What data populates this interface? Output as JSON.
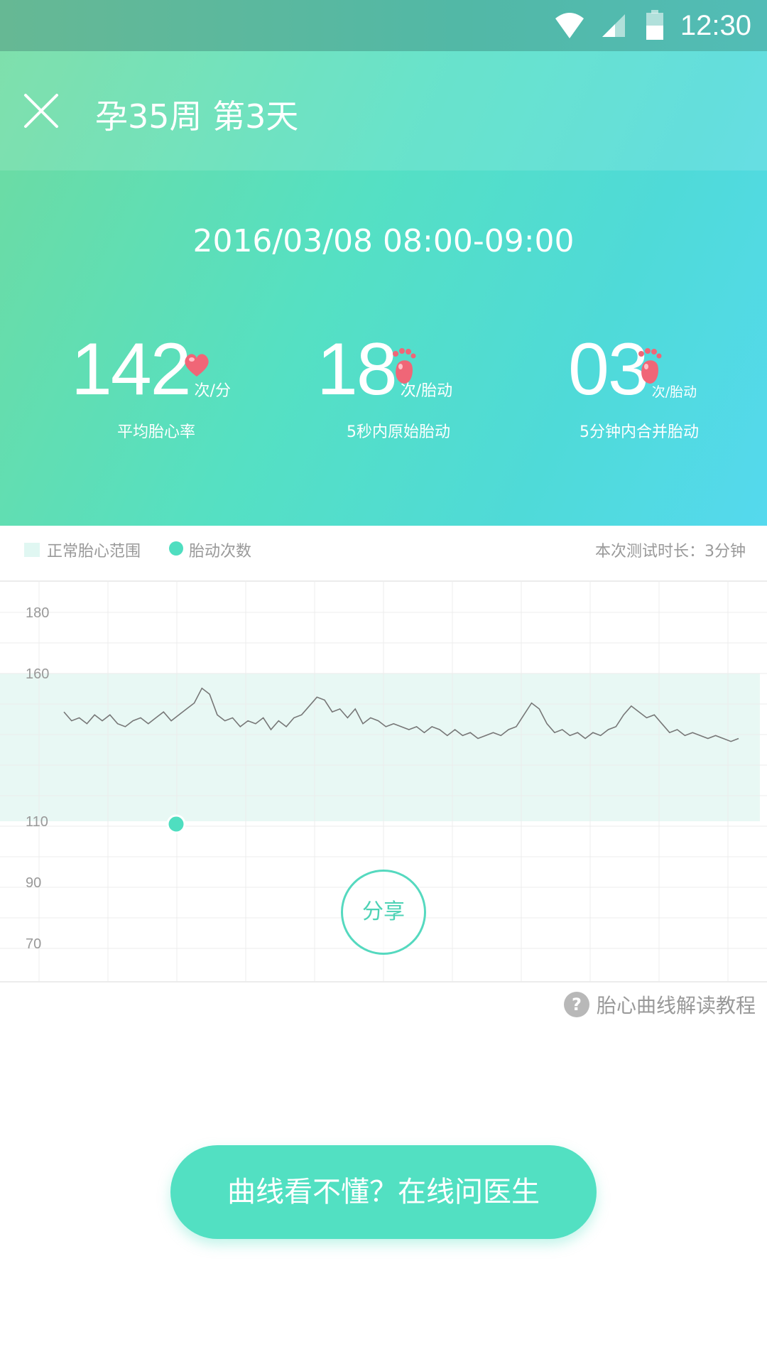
{
  "status_bar": {
    "time": "12:30"
  },
  "header": {
    "title": "孕35周 第3天"
  },
  "date_range": "2016/03/08  08:00-09:00",
  "stats": [
    {
      "value": "142",
      "unit": "次/分",
      "label": "平均胎心率",
      "icon": "heart-icon"
    },
    {
      "value": "18",
      "unit": "次/胎动",
      "label": "5秒内原始胎动",
      "icon": "footprint-icon"
    },
    {
      "value": "03",
      "unit": "次/胎动",
      "label": "5分钟内合并胎动",
      "icon": "footprint-icon"
    }
  ],
  "legend": {
    "normal_range_label": "正常胎心范围",
    "movement_label": "胎动次数",
    "duration": "本次测试时长：3分钟"
  },
  "chart_data": {
    "type": "line",
    "y_ticks": [
      180,
      160,
      110,
      90,
      70
    ],
    "normal_range": [
      110,
      160
    ],
    "series": [
      {
        "values": [
          147,
          144,
          145,
          143,
          146,
          144,
          146,
          143,
          142,
          144,
          145,
          143,
          145,
          147,
          144,
          146,
          148,
          150,
          155,
          153,
          146,
          144,
          145,
          142,
          144,
          143,
          145,
          141,
          144,
          142,
          145,
          146,
          149,
          152,
          151,
          147,
          148,
          145,
          148,
          143,
          145,
          144,
          142,
          143,
          142,
          141,
          142,
          140,
          142,
          141,
          139,
          141,
          139,
          140,
          138,
          139,
          140,
          139,
          141,
          142,
          146,
          150,
          148,
          143,
          140,
          141,
          139,
          140,
          138,
          140,
          139,
          141,
          142,
          146,
          149,
          147,
          145,
          146,
          143,
          140,
          141,
          139,
          140,
          139,
          138,
          139,
          138,
          137,
          138
        ]
      }
    ],
    "movement_points": [
      110
    ],
    "colors": {
      "line": "#777777",
      "range_fill": "#e8f8f4",
      "grid": "#ececec",
      "dot": "#4fdec0"
    }
  },
  "share_label": "分享",
  "help_label": "胎心曲线解读教程",
  "cta_label": "曲线看不懂？在线问医生"
}
